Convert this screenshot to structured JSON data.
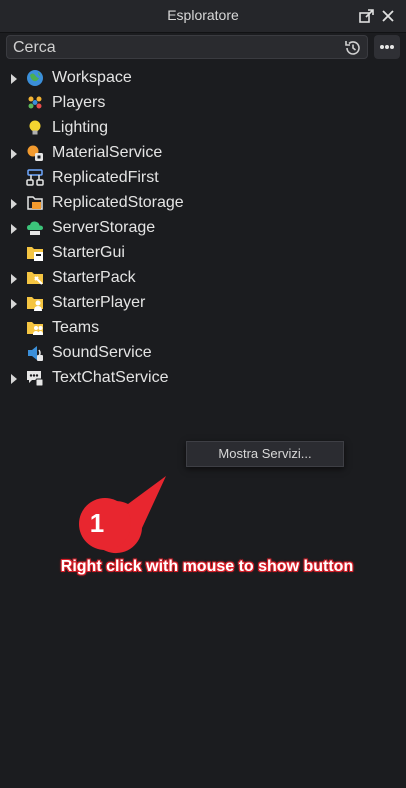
{
  "window": {
    "title": "Esploratore"
  },
  "search": {
    "placeholder": "Cerca",
    "value": ""
  },
  "tree": {
    "items": [
      {
        "label": "Workspace",
        "expandable": true,
        "icon": "workspace-globe-icon"
      },
      {
        "label": "Players",
        "expandable": false,
        "icon": "players-icon"
      },
      {
        "label": "Lighting",
        "expandable": false,
        "icon": "lighting-bulb-icon"
      },
      {
        "label": "MaterialService",
        "expandable": true,
        "icon": "material-service-icon"
      },
      {
        "label": "ReplicatedFirst",
        "expandable": false,
        "icon": "replicated-first-icon"
      },
      {
        "label": "ReplicatedStorage",
        "expandable": true,
        "icon": "replicated-storage-icon"
      },
      {
        "label": "ServerStorage",
        "expandable": true,
        "icon": "server-storage-icon"
      },
      {
        "label": "StarterGui",
        "expandable": false,
        "icon": "starter-gui-icon"
      },
      {
        "label": "StarterPack",
        "expandable": true,
        "icon": "starter-pack-icon"
      },
      {
        "label": "StarterPlayer",
        "expandable": true,
        "icon": "starter-player-icon"
      },
      {
        "label": "Teams",
        "expandable": false,
        "icon": "teams-icon"
      },
      {
        "label": "SoundService",
        "expandable": false,
        "icon": "sound-service-icon"
      },
      {
        "label": "TextChatService",
        "expandable": true,
        "icon": "text-chat-service-icon"
      }
    ]
  },
  "context_menu": {
    "item_label": "Mostra Servizi..."
  },
  "annotation": {
    "number": "1",
    "text": "Right click with mouse to show button",
    "color": "#e8262f"
  },
  "colors": {
    "background": "#1b1c1f",
    "titlebar": "#25262a",
    "annotation_red": "#e8262f"
  }
}
